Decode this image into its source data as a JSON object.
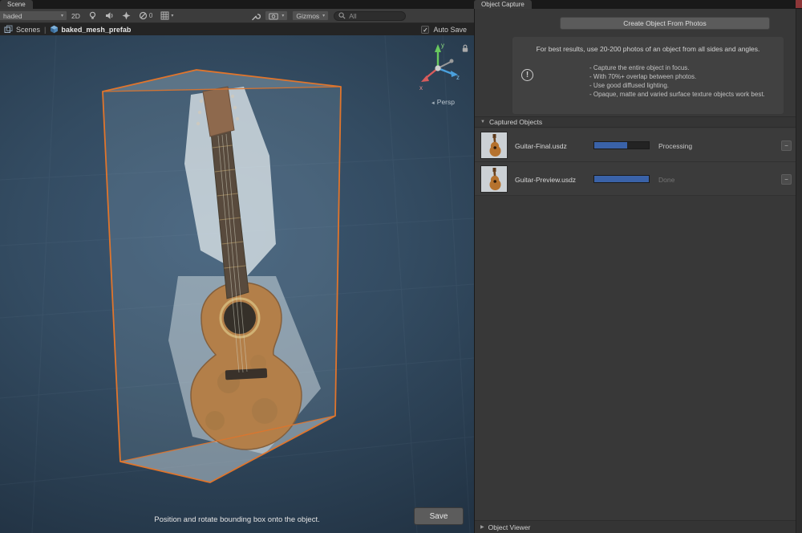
{
  "icons": {
    "fold_open": "▼",
    "fold_closed": "▶",
    "check": "✓",
    "caret": "▾",
    "persp_arrow": "◄",
    "row_action": "−",
    "info_mark": "!"
  },
  "scene_panel": {
    "tab_label": "Scene",
    "toolbar": {
      "draw_mode": "haded",
      "mode_2d": "2D",
      "hidden_count": "0",
      "gizmos_label": "Gizmos",
      "search_text": "All"
    },
    "breadcrumb": {
      "scenes_label": "Scenes",
      "separator": "|",
      "prefab_name": "baked_mesh_prefab"
    },
    "auto_save_label": "Auto Save",
    "view_gizmo": {
      "x_label": "x",
      "y_label": "y",
      "z_label": "z",
      "projection": "Persp"
    },
    "hint": "Position and rotate bounding box onto the object.",
    "save_label": "Save"
  },
  "capture_panel": {
    "tab_label": "Object Capture",
    "create_button_label": "Create Object From Photos",
    "info": {
      "headline": "For best results, use 20-200 photos of an object from all sides and angles.",
      "bullets": [
        "- Capture the entire object in focus.",
        "- With 70%+ overlap between photos.",
        "- Use good diffused lighting.",
        "- Opaque, matte and varied surface texture objects work best."
      ]
    },
    "captured_objects": {
      "header_label": "Captured Objects",
      "items": [
        {
          "name": "Guitar-Final.usdz",
          "status": "Processing",
          "progress": 60
        },
        {
          "name": "Guitar-Preview.usdz",
          "status": "Done",
          "progress": 100
        }
      ]
    },
    "object_viewer_label": "Object Viewer"
  },
  "colors": {
    "bounding_box_orange": "#E0752C",
    "progress_blue": "#3A62A8",
    "viewport_blue": "#35506A"
  }
}
